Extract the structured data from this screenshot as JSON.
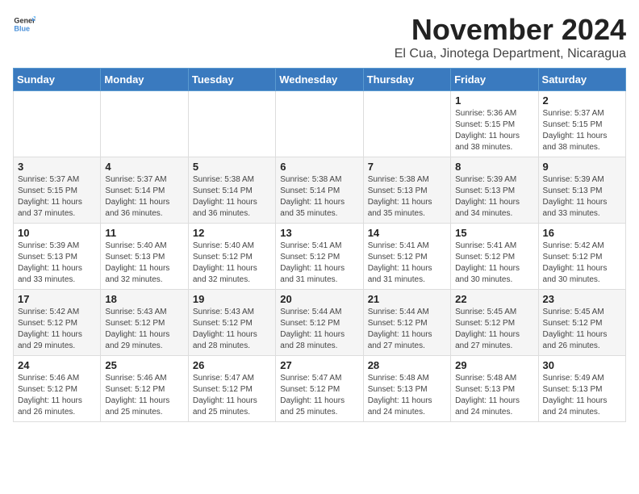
{
  "logo": {
    "general": "General",
    "blue": "Blue"
  },
  "title": "November 2024",
  "subtitle": "El Cua, Jinotega Department, Nicaragua",
  "headers": [
    "Sunday",
    "Monday",
    "Tuesday",
    "Wednesday",
    "Thursday",
    "Friday",
    "Saturday"
  ],
  "weeks": [
    [
      {
        "day": "",
        "info": ""
      },
      {
        "day": "",
        "info": ""
      },
      {
        "day": "",
        "info": ""
      },
      {
        "day": "",
        "info": ""
      },
      {
        "day": "",
        "info": ""
      },
      {
        "day": "1",
        "info": "Sunrise: 5:36 AM\nSunset: 5:15 PM\nDaylight: 11 hours and 38 minutes."
      },
      {
        "day": "2",
        "info": "Sunrise: 5:37 AM\nSunset: 5:15 PM\nDaylight: 11 hours and 38 minutes."
      }
    ],
    [
      {
        "day": "3",
        "info": "Sunrise: 5:37 AM\nSunset: 5:15 PM\nDaylight: 11 hours and 37 minutes."
      },
      {
        "day": "4",
        "info": "Sunrise: 5:37 AM\nSunset: 5:14 PM\nDaylight: 11 hours and 36 minutes."
      },
      {
        "day": "5",
        "info": "Sunrise: 5:38 AM\nSunset: 5:14 PM\nDaylight: 11 hours and 36 minutes."
      },
      {
        "day": "6",
        "info": "Sunrise: 5:38 AM\nSunset: 5:14 PM\nDaylight: 11 hours and 35 minutes."
      },
      {
        "day": "7",
        "info": "Sunrise: 5:38 AM\nSunset: 5:13 PM\nDaylight: 11 hours and 35 minutes."
      },
      {
        "day": "8",
        "info": "Sunrise: 5:39 AM\nSunset: 5:13 PM\nDaylight: 11 hours and 34 minutes."
      },
      {
        "day": "9",
        "info": "Sunrise: 5:39 AM\nSunset: 5:13 PM\nDaylight: 11 hours and 33 minutes."
      }
    ],
    [
      {
        "day": "10",
        "info": "Sunrise: 5:39 AM\nSunset: 5:13 PM\nDaylight: 11 hours and 33 minutes."
      },
      {
        "day": "11",
        "info": "Sunrise: 5:40 AM\nSunset: 5:13 PM\nDaylight: 11 hours and 32 minutes."
      },
      {
        "day": "12",
        "info": "Sunrise: 5:40 AM\nSunset: 5:12 PM\nDaylight: 11 hours and 32 minutes."
      },
      {
        "day": "13",
        "info": "Sunrise: 5:41 AM\nSunset: 5:12 PM\nDaylight: 11 hours and 31 minutes."
      },
      {
        "day": "14",
        "info": "Sunrise: 5:41 AM\nSunset: 5:12 PM\nDaylight: 11 hours and 31 minutes."
      },
      {
        "day": "15",
        "info": "Sunrise: 5:41 AM\nSunset: 5:12 PM\nDaylight: 11 hours and 30 minutes."
      },
      {
        "day": "16",
        "info": "Sunrise: 5:42 AM\nSunset: 5:12 PM\nDaylight: 11 hours and 30 minutes."
      }
    ],
    [
      {
        "day": "17",
        "info": "Sunrise: 5:42 AM\nSunset: 5:12 PM\nDaylight: 11 hours and 29 minutes."
      },
      {
        "day": "18",
        "info": "Sunrise: 5:43 AM\nSunset: 5:12 PM\nDaylight: 11 hours and 29 minutes."
      },
      {
        "day": "19",
        "info": "Sunrise: 5:43 AM\nSunset: 5:12 PM\nDaylight: 11 hours and 28 minutes."
      },
      {
        "day": "20",
        "info": "Sunrise: 5:44 AM\nSunset: 5:12 PM\nDaylight: 11 hours and 28 minutes."
      },
      {
        "day": "21",
        "info": "Sunrise: 5:44 AM\nSunset: 5:12 PM\nDaylight: 11 hours and 27 minutes."
      },
      {
        "day": "22",
        "info": "Sunrise: 5:45 AM\nSunset: 5:12 PM\nDaylight: 11 hours and 27 minutes."
      },
      {
        "day": "23",
        "info": "Sunrise: 5:45 AM\nSunset: 5:12 PM\nDaylight: 11 hours and 26 minutes."
      }
    ],
    [
      {
        "day": "24",
        "info": "Sunrise: 5:46 AM\nSunset: 5:12 PM\nDaylight: 11 hours and 26 minutes."
      },
      {
        "day": "25",
        "info": "Sunrise: 5:46 AM\nSunset: 5:12 PM\nDaylight: 11 hours and 25 minutes."
      },
      {
        "day": "26",
        "info": "Sunrise: 5:47 AM\nSunset: 5:12 PM\nDaylight: 11 hours and 25 minutes."
      },
      {
        "day": "27",
        "info": "Sunrise: 5:47 AM\nSunset: 5:12 PM\nDaylight: 11 hours and 25 minutes."
      },
      {
        "day": "28",
        "info": "Sunrise: 5:48 AM\nSunset: 5:13 PM\nDaylight: 11 hours and 24 minutes."
      },
      {
        "day": "29",
        "info": "Sunrise: 5:48 AM\nSunset: 5:13 PM\nDaylight: 11 hours and 24 minutes."
      },
      {
        "day": "30",
        "info": "Sunrise: 5:49 AM\nSunset: 5:13 PM\nDaylight: 11 hours and 24 minutes."
      }
    ]
  ]
}
